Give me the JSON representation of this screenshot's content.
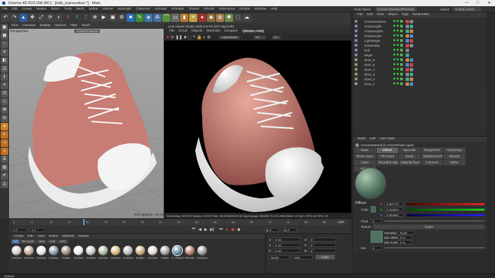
{
  "titlebar": {
    "title": "Cinema 4D R23.008 (RC) - [lsdb_d.procedure *] - Main",
    "minimize": "—",
    "maximize": "□",
    "close": "✕"
  },
  "menu": [
    "File",
    "Edit",
    "Create",
    "Modes",
    "Select",
    "Tools",
    "Mesh",
    "Spline",
    "Volume",
    "MoGraph",
    "Character",
    "Animate",
    "Simulate",
    "Tracker",
    "Render",
    "Extensions",
    "Octane",
    "Window",
    "Help"
  ],
  "menu_right": {
    "node_space_label": "Node Space",
    "node_space_value": "Current (Standard/Physical)",
    "layout_label": "Layout",
    "layout_value": "Cobray (User)"
  },
  "viewport": {
    "menus": [
      "View",
      "Cameras",
      "Display",
      "Options",
      "Filter",
      "Panel"
    ],
    "label": "Perspective",
    "camera": "OctaneCamera",
    "status": "Grid Spacing : 50 cm"
  },
  "liveviewer": {
    "title": "Live Viewer Studio 2020.2.5-R3 (107 days left)",
    "menus": [
      "File",
      "Cloud",
      "Objects",
      "Materials",
      "Compare",
      "Options",
      "Help"
    ],
    "render_label": "[RENDERING]",
    "colorspace": "HDR/sRGB",
    "camera": "PT",
    "value": "0.7",
    "status": "Rendering: 100.00%  Ms/sec: 23.003  Time: 00:00:08/00:00:08  Spp/maxspp: 800/800  Tri: 0/1.003k  Mesh: 14  Hair: 0  RTX:off  GPU: 73"
  },
  "objects": {
    "menus": [
      "File",
      "Edit",
      "View",
      "Object",
      "Tags",
      "Bookmarks"
    ],
    "items": [
      "OctaneCamera",
      "OctaneLight",
      "OctaneLight1",
      "OctaneLight",
      "LightTarget",
      "OctaneSky",
      "Null",
      "target",
      "shoe_6",
      "shoe_5",
      "shoe_4",
      "shoe_3",
      "shoe_2",
      "shoe_1"
    ]
  },
  "attributes": {
    "menus": [
      "Mode",
      "Edit",
      "User Data"
    ],
    "material_name": "OctaneMaterial [C.GreenPlasticAged]",
    "tabs": [
      "Basic",
      "Diffuse",
      "Specular",
      "Roughness",
      "Anisotropy",
      "Sheen layer",
      "Film layer",
      "Bump",
      "Displacement",
      "Opacity",
      "Index",
      "Rounded edges",
      "Material layer",
      "Common",
      "Editor",
      "Assign"
    ],
    "active_tab": "Diffuse",
    "section": "Diffuse",
    "color_label": "Color",
    "r_label": "R",
    "r_value": "0.287771",
    "g_label": "G",
    "g_value": "0.412541",
    "b_label": "B",
    "b_value": "0.354997",
    "float_label": "Float",
    "float_value": "0",
    "texture_label": "Texture",
    "texture_type": "Noise",
    "sampling_label": "Sampling",
    "sampling_value": "None",
    "blur_offset_label": "Blur Offset",
    "blur_offset_value": "0 %",
    "blur_scale_label": "Blur Scale",
    "blur_scale_value": "0 %",
    "mix_label": "Mix",
    "mix_value": "0"
  },
  "timeline": {
    "start": "0 F",
    "end": "90 F",
    "current": "0 F",
    "fps": "90 F",
    "ticks": [
      "0",
      "5",
      "10",
      "15",
      "20",
      "25",
      "30",
      "35",
      "40",
      "45",
      "50",
      "55",
      "60",
      "65",
      "70",
      "75",
      "80",
      "85",
      "90"
    ],
    "frame_field": "18 F"
  },
  "materials": {
    "menus": [
      "Create",
      "Edit",
      "View",
      "Select",
      "Material",
      "Texture"
    ],
    "tabs": [
      "All",
      "No Layer",
      "set1",
      "set2",
      "set3"
    ],
    "items": [
      "OctGlos",
      "OctGlos",
      "OctGlos",
      "OctGlos",
      "OctMix",
      "OctGlos",
      "OctGlos",
      "OctGlos",
      "OctGlos",
      "OctGlos",
      "OctMix",
      "OctGlos",
      "OctMix",
      "O_GlamB",
      "Refl Mix",
      "OctSpec"
    ]
  },
  "coords": {
    "labels": [
      "X",
      "Y",
      "Z"
    ],
    "values": [
      "0 cm",
      "0 cm",
      "0 cm"
    ],
    "rot_labels": [
      "H",
      "P",
      "B"
    ],
    "rot_values": [
      "0 °",
      "0 °",
      "0 °"
    ],
    "mode": "World",
    "scale": "Size",
    "apply": "Apply"
  },
  "statusbar": "Octane"
}
